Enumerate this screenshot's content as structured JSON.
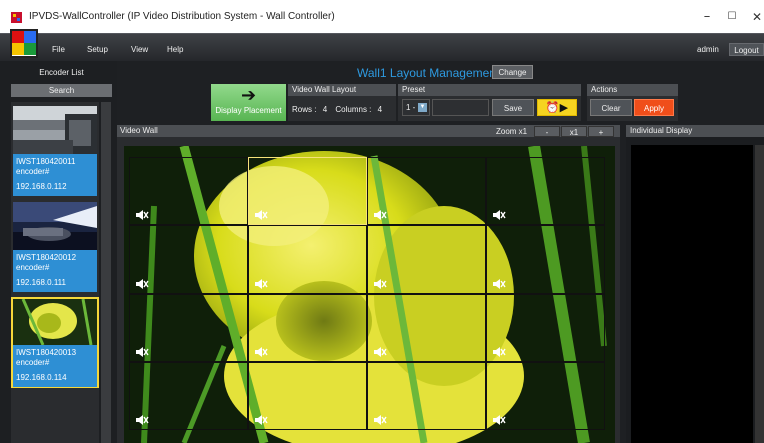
{
  "window": {
    "title": "IPVDS-WallController (IP Video Distribution System - Wall Controller)",
    "controls": [
      "–",
      "☐",
      "✕"
    ]
  },
  "menu": [
    "File",
    "Setup",
    "View",
    "Help"
  ],
  "user": {
    "name": "admin",
    "logout_label": "Logout"
  },
  "encoder_panel": {
    "title": "Encoder List",
    "search_label": "Search",
    "encoders": [
      {
        "name": "IWST180420011",
        "type": "encoder#",
        "ip": "192.168.0.112"
      },
      {
        "name": "IWST180420012",
        "type": "encoder#",
        "ip": "192.168.0.111"
      },
      {
        "name": "IWST180420013",
        "type": "encoder#",
        "ip": "192.168.0.114",
        "selected": true
      }
    ]
  },
  "header": {
    "title": "Wall1 Layout Management",
    "change_label": "Change"
  },
  "display_placement": {
    "label": "Display Placement"
  },
  "video_wall_layout": {
    "title": "Video Wall Layout",
    "rows_label": "Rows :",
    "rows": "4",
    "columns_label": "Columns :",
    "columns": "4"
  },
  "preset": {
    "title": "Preset",
    "selected": "1 -",
    "name": "",
    "save_label": "Save"
  },
  "actions": {
    "title": "Actions",
    "clear_label": "Clear",
    "apply_label": "Apply"
  },
  "video_wall": {
    "title": "Video Wall",
    "zoom_label": "Zoom x1",
    "zoom_out": "-",
    "zoom_value": "x1",
    "zoom_in": "+",
    "rows": 4,
    "columns": 4,
    "selected_cell": [
      0,
      1
    ]
  },
  "individual_display": {
    "title": "Individual Display"
  },
  "colors": {
    "accent": "#2e9ae0",
    "apply": "#f04e1a",
    "encoder_card": "#2e8fd4",
    "selection": "#f6e27a"
  },
  "icons": [
    "app-icon",
    "speaker-mute-icon",
    "alarm-clock-icon",
    "play-icon",
    "arrow-right-icon",
    "dropdown-icon"
  ]
}
